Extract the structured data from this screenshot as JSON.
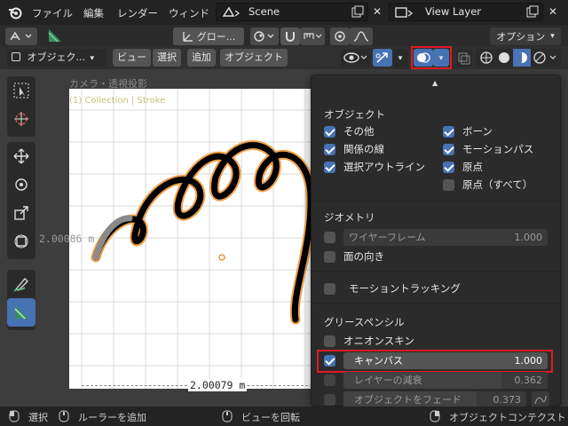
{
  "menubar": {
    "items": [
      "ファイル",
      "編集",
      "レンダー",
      "ウィンド"
    ],
    "scene": "Scene",
    "view_layer": "View Layer"
  },
  "header2": {
    "transform_dropdown": "グロー...",
    "options": "オプション"
  },
  "header3": {
    "mode": "オブジェク...",
    "view": "ビュー",
    "select": "選択",
    "add": "追加",
    "object": "オブジェクト"
  },
  "viewport": {
    "camera_label": "カメラ・透視投影",
    "collection_label": "(1) Collection | Stroke",
    "measure_vertical": "2.00086 m",
    "measure_horizontal": "2.00079 m"
  },
  "overlays": {
    "object_title": "オブジェクト",
    "object_items": [
      {
        "label": "その他",
        "checked": true
      },
      {
        "label": "関係の線",
        "checked": true
      },
      {
        "label": "選択アウトライン",
        "checked": true
      },
      {
        "label": "ボーン",
        "checked": true
      },
      {
        "label": "モーションパス",
        "checked": true
      },
      {
        "label": "原点",
        "checked": true
      },
      {
        "label": "原点（すべて）",
        "checked": false
      }
    ],
    "geometry_title": "ジオメトリ",
    "wireframe_label": "ワイヤーフレーム",
    "wireframe_value": "1.000",
    "face_orientation": "面の向き",
    "motion_tracking": "モーショントラッキング",
    "gp_title": "グリースペンシル",
    "onion_skin": "オニオンスキン",
    "canvas_label": "キャンバス",
    "canvas_value": "1.000",
    "layer_fade_label": "レイヤーの減衰",
    "layer_fade_value": "0.362",
    "object_fade_label": "オブジェクトをフェード",
    "object_fade_value": "0.373"
  },
  "statusbar": {
    "select": "選択",
    "add_ruler": "ルーラーを追加",
    "rotate_view": "ビューを回転",
    "context_menu": "オブジェクトコンテクスト"
  },
  "colors": {
    "accent": "#4772b3",
    "highlight_box": "#e01a22",
    "stroke": "#000000",
    "outline": "#f29d3c"
  }
}
